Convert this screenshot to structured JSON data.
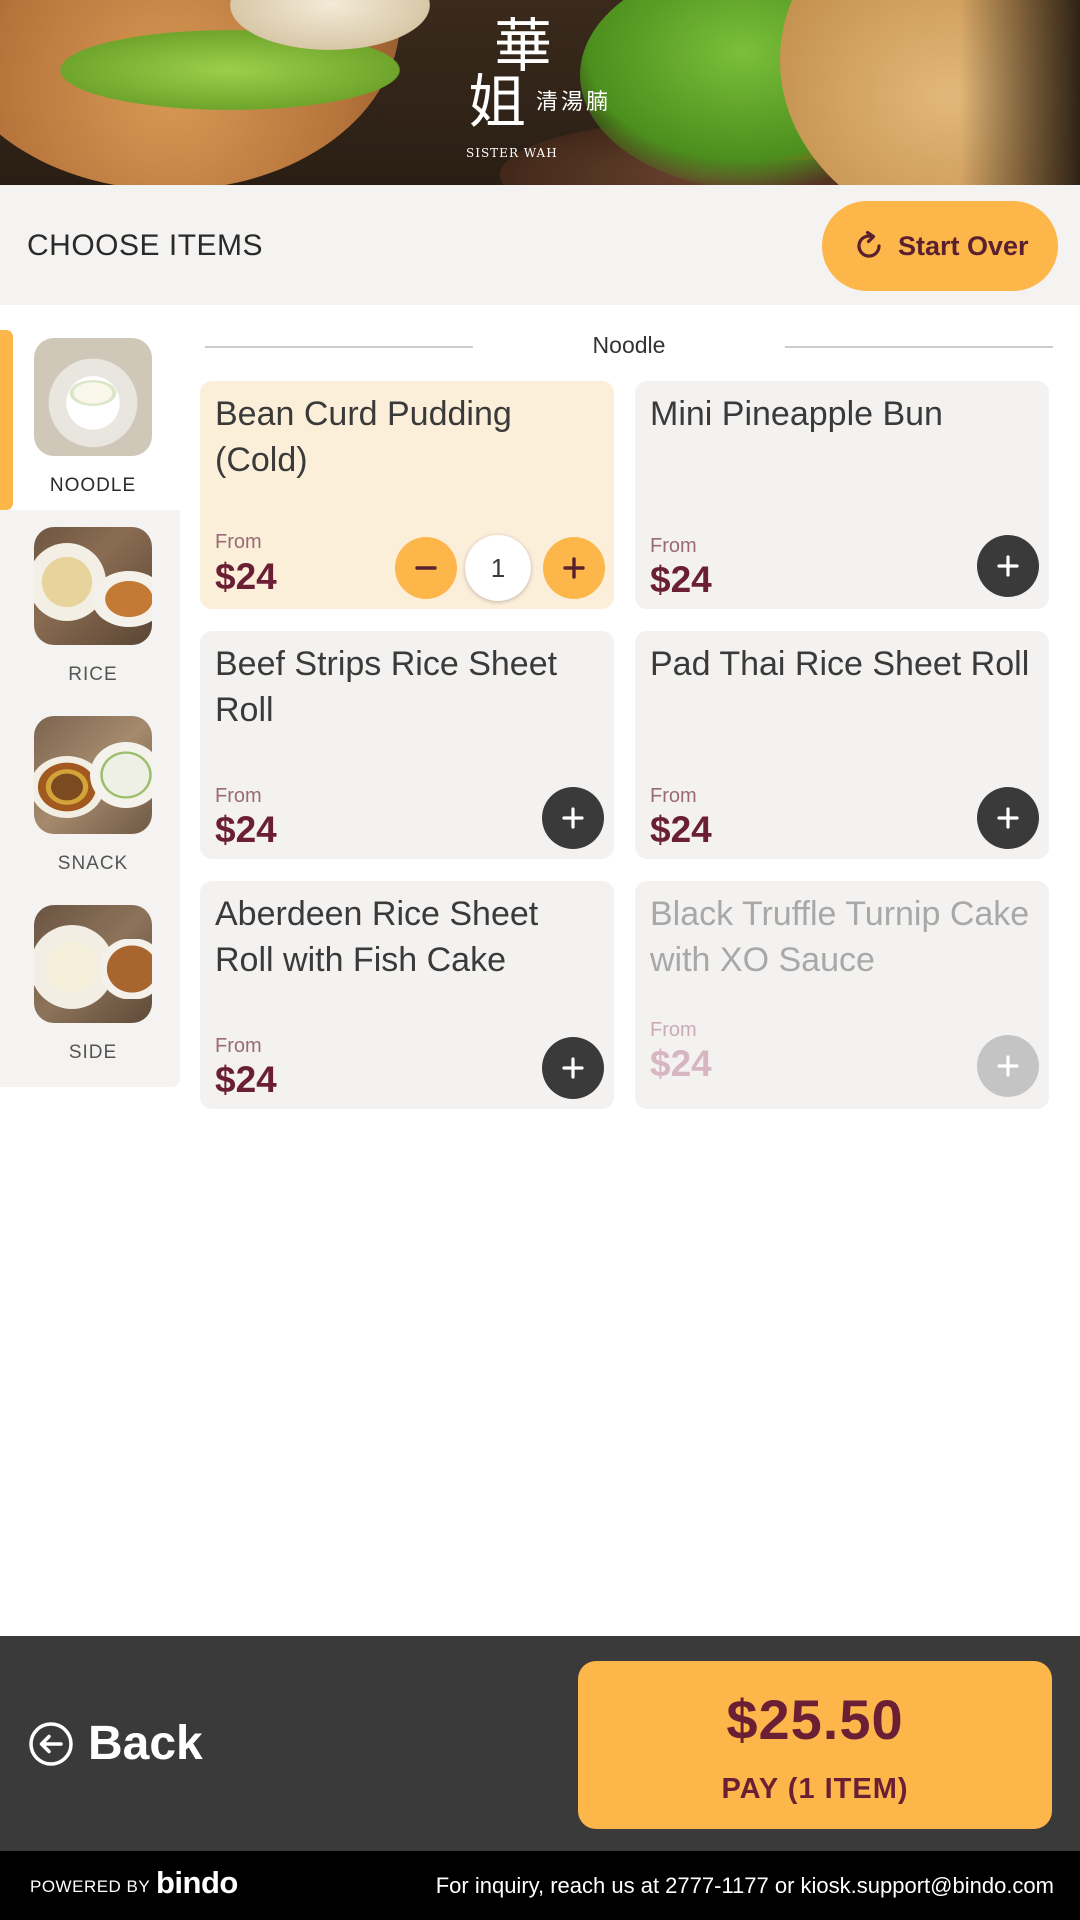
{
  "hero": {
    "logo_char_1": "華",
    "logo_char_2": "姐",
    "logo_subtitle": "清湯腩",
    "logo_english": "SISTER WAH"
  },
  "header": {
    "title": "CHOOSE ITEMS",
    "start_over_label": "Start Over",
    "start_over_icon": "refresh-icon"
  },
  "sidebar": {
    "categories": [
      {
        "label": "NOODLE",
        "active": true
      },
      {
        "label": "RICE",
        "active": false
      },
      {
        "label": "SNACK",
        "active": false
      },
      {
        "label": "SIDE",
        "active": false
      }
    ]
  },
  "section": {
    "title": "Noodle"
  },
  "products": [
    {
      "name": "Bean Curd Pudding (Cold)",
      "from": "From",
      "price": "$24",
      "quantity": "1",
      "selected": true,
      "available": true
    },
    {
      "name": "Mini Pineapple Bun",
      "from": "From",
      "price": "$24",
      "selected": false,
      "available": true
    },
    {
      "name": "Beef Strips Rice Sheet Roll",
      "from": "From",
      "price": "$24",
      "selected": false,
      "available": true
    },
    {
      "name": "Pad Thai Rice Sheet Roll",
      "from": "From",
      "price": "$24",
      "selected": false,
      "available": true
    },
    {
      "name": "Aberdeen Rice Sheet Roll with Fish Cake",
      "from": "From",
      "price": "$24",
      "selected": false,
      "available": true
    },
    {
      "name": "Black Truffle Turnip Cake with XO Sauce",
      "from": "From",
      "price": "$24",
      "selected": false,
      "available": false
    }
  ],
  "bottom_bar": {
    "back_label": "Back",
    "pay_total": "$25.50",
    "pay_label": "PAY (1 ITEM)"
  },
  "footer": {
    "powered_by": "POWERED BY",
    "brand": "bindo",
    "inquiry": "For inquiry, reach us at 2777-1177 or  kiosk.support@bindo.com"
  },
  "colors": {
    "accent": "#fdb64a",
    "price": "#6b1f35",
    "dark": "#3a3a3b",
    "selected_card": "#fcefd9",
    "card": "#f3f2f0"
  }
}
